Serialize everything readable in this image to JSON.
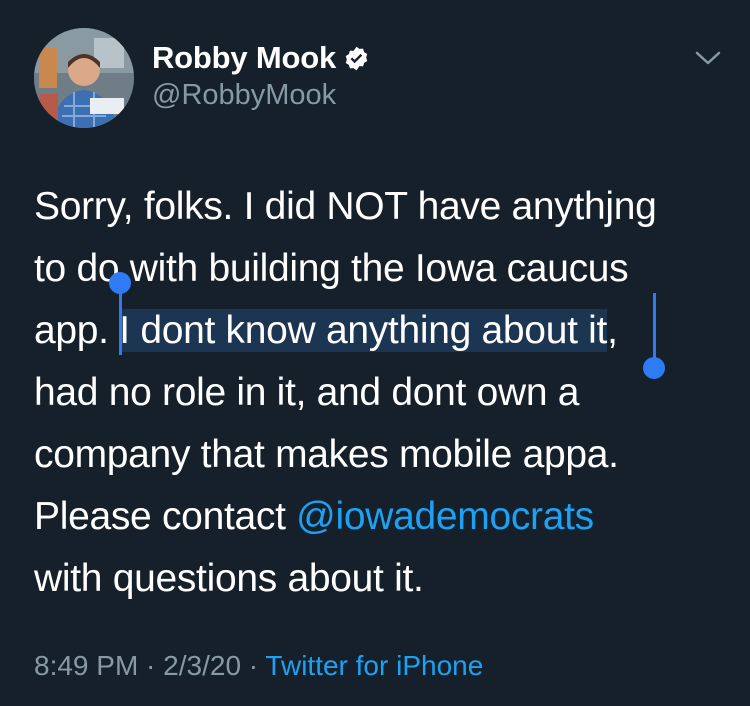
{
  "author": {
    "name": "Robby Mook",
    "handle": "@RobbyMook"
  },
  "tweet": {
    "line1": "Sorry, folks. I did NOT have anythjng",
    "line2": "to do with building the Iowa caucus",
    "line3_before": "app. ",
    "line3_selected": "I dont know anything about it",
    "line3_after": ",",
    "line4": "had no role in it, and dont own a",
    "line5": "company that makes mobile appa.",
    "line6_before": "Please contact ",
    "line6_mention": "@iowademocrats",
    "line7": "with questions about it."
  },
  "meta": {
    "time": "8:49 PM",
    "sep1": " · ",
    "date": "2/3/20",
    "sep2": " · ",
    "source": "Twitter for iPhone"
  },
  "icons": {
    "verified": "verified-badge-icon",
    "caret": "chevron-down-icon"
  },
  "colors": {
    "background": "#15202b",
    "link": "#1da1f2",
    "secondary_text": "#8899a6",
    "selection": "#1c3552",
    "selection_handle": "#2f7bf5"
  }
}
